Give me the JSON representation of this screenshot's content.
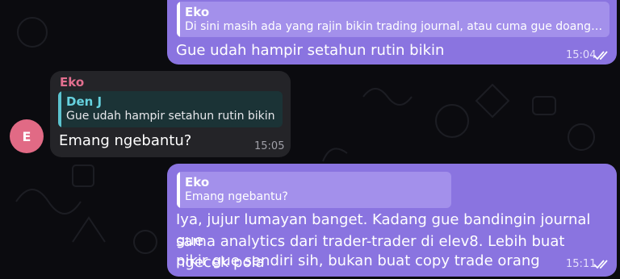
{
  "messages": [
    {
      "reply": {
        "name": "Eko",
        "text": "Di sini masih ada yang rajin bikin trading journal, atau cuma gue doang ..."
      },
      "text": "Gue udah hampir setahun rutin bikin",
      "time": "15:04",
      "read": true
    },
    {
      "sender": "Eko",
      "avatar_initial": "E",
      "reply": {
        "name": "Den J",
        "text": "Gue udah hampir setahun rutin bikin"
      },
      "text": "Emang ngebantu?",
      "time": "15:05"
    },
    {
      "reply": {
        "name": "Eko",
        "text": "Emang ngebantu?"
      },
      "lines": [
        "Iya, jujur lumayan banget. Kadang gue bandingin journal gue",
        "sama analytics dari trader-trader di elev8. Lebih buat ngecek pola",
        "pikir gue sendiri sih, bukan buat copy trade orang"
      ],
      "time": "15:11",
      "read": true
    }
  ],
  "colors": {
    "outgoing_bubble": "#8a74e0",
    "incoming_bubble": "#242428",
    "avatar": "#e16a85",
    "sender_name": "#e36f8f",
    "reply_incoming_accent": "#66d2df"
  }
}
